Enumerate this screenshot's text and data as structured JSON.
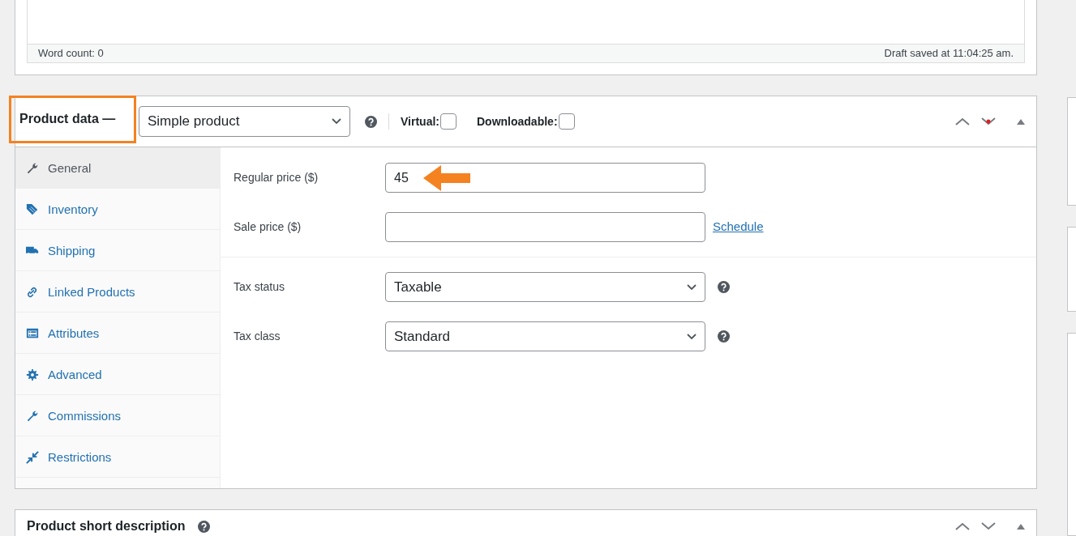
{
  "editor": {
    "word_count": "Word count: 0",
    "draft_status": "Draft saved at 11:04:25 am."
  },
  "product_data": {
    "title": "Product data —",
    "product_type": "Simple product",
    "virtual": {
      "label": "Virtual:",
      "checked": false
    },
    "downloadable": {
      "label": "Downloadable:",
      "checked": false
    },
    "tabs": [
      {
        "label": "General",
        "kind": "wrench",
        "selected": true
      },
      {
        "label": "Inventory",
        "kind": "tag",
        "selected": false
      },
      {
        "label": "Shipping",
        "kind": "truck",
        "selected": false
      },
      {
        "label": "Linked Products",
        "kind": "link",
        "selected": false
      },
      {
        "label": "Attributes",
        "kind": "list",
        "selected": false
      },
      {
        "label": "Advanced",
        "kind": "gear",
        "selected": false
      },
      {
        "label": "Commissions",
        "kind": "wrench",
        "selected": false
      },
      {
        "label": "Restrictions",
        "kind": "arrows",
        "selected": false
      }
    ],
    "pricing": [
      {
        "label": "Regular price ($)",
        "value": "45"
      },
      {
        "label": "Sale price ($)",
        "link": "Schedule"
      }
    ],
    "tax": [
      {
        "label": "Tax status",
        "value": "Taxable"
      },
      {
        "label": "Tax class",
        "value": "Standard"
      }
    ]
  },
  "short_description": {
    "title": "Product short description"
  }
}
